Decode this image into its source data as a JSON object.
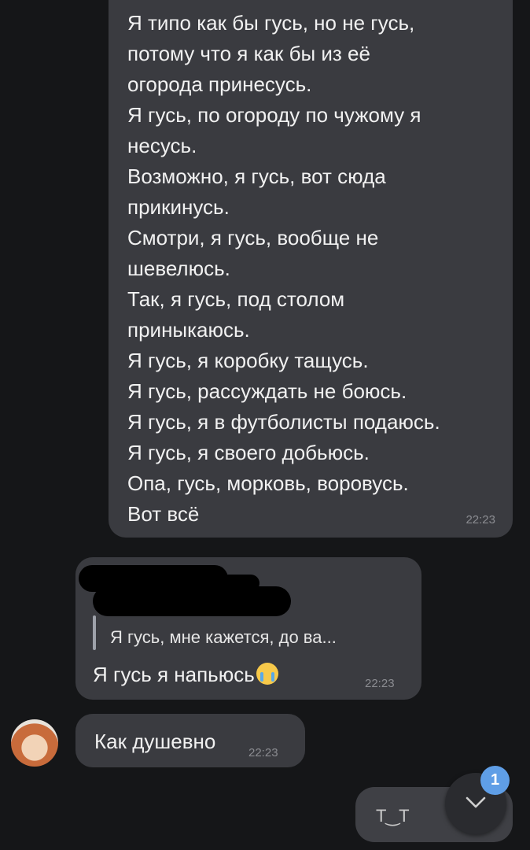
{
  "messages": {
    "song": {
      "lines": [
        "Я типо как бы гусь, но не гусь,",
        "потому что я как бы из её",
        "огорода принесусь.",
        "Я гусь, по огороду по чужому я",
        "несусь.",
        "Возможно, я гусь, вот сюда",
        "прикинусь.",
        "Смотри, я гусь, вообще не",
        "шевелюсь.",
        "Так, я гусь, под столом",
        "приныкаюсь.",
        "Я гусь, я коробку тащусь.",
        "Я гусь, рассуждать не боюсь.",
        "Я гусь, я в футболисты подаюсь.",
        "Я гусь, я своего добьюсь.",
        "Опа, гусь, морковь, воровусь.",
        "Вот всё"
      ],
      "time": "22:23"
    },
    "reply": {
      "quote": "Я гусь, мне кажется, до ва...",
      "text": "Я гусь я напьюсь",
      "emoji": "crying-face-emoji",
      "time": "22:23"
    },
    "incoming": {
      "text": "Как душевно",
      "time": "22:23"
    },
    "outgoing": {
      "text": "T‿T"
    }
  },
  "scroll_button": {
    "icon": "chevron-down-icon",
    "badge": "1"
  },
  "colors": {
    "background": "#151618",
    "bubble": "#3a3b40",
    "badge": "#5f9ee6"
  }
}
